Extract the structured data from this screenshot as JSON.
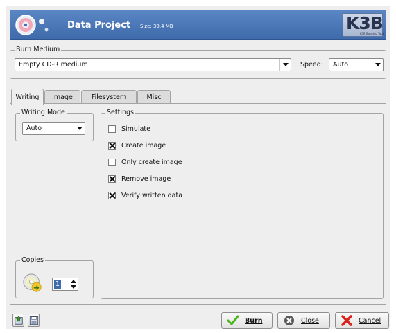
{
  "header": {
    "title": "Data Project",
    "size_text": "Size: 39.4 MB",
    "logo_text": "K3B",
    "logo_subtext": "K3B Burning Tool"
  },
  "burn_medium": {
    "group_title": "Burn Medium",
    "medium_value": "Empty CD-R medium",
    "speed_label": "Speed:",
    "speed_value": "Auto"
  },
  "tabs": [
    {
      "label": "Writing",
      "active": true
    },
    {
      "label": "Image",
      "active": false
    },
    {
      "label": "Filesystem",
      "active": false
    },
    {
      "label": "Misc",
      "active": false
    }
  ],
  "writing_mode": {
    "group_title": "Writing Mode",
    "value": "Auto"
  },
  "settings": {
    "group_title": "Settings",
    "options": [
      {
        "label": "Simulate",
        "checked": false
      },
      {
        "label": "Create image",
        "checked": true
      },
      {
        "label": "Only create image",
        "checked": false
      },
      {
        "label": "Remove image",
        "checked": true
      },
      {
        "label": "Verify written data",
        "checked": true
      }
    ]
  },
  "copies": {
    "group_title": "Copies",
    "value": "1"
  },
  "footer": {
    "burn_label": "Burn",
    "close_label": "Close",
    "cancel_label": "Cancel",
    "load_icon": "load-settings-icon",
    "save_icon": "save-settings-icon"
  },
  "colors": {
    "header_blue": "#3f6aab",
    "burn_check": "#4ab51b",
    "cancel_x": "#d8231c"
  }
}
